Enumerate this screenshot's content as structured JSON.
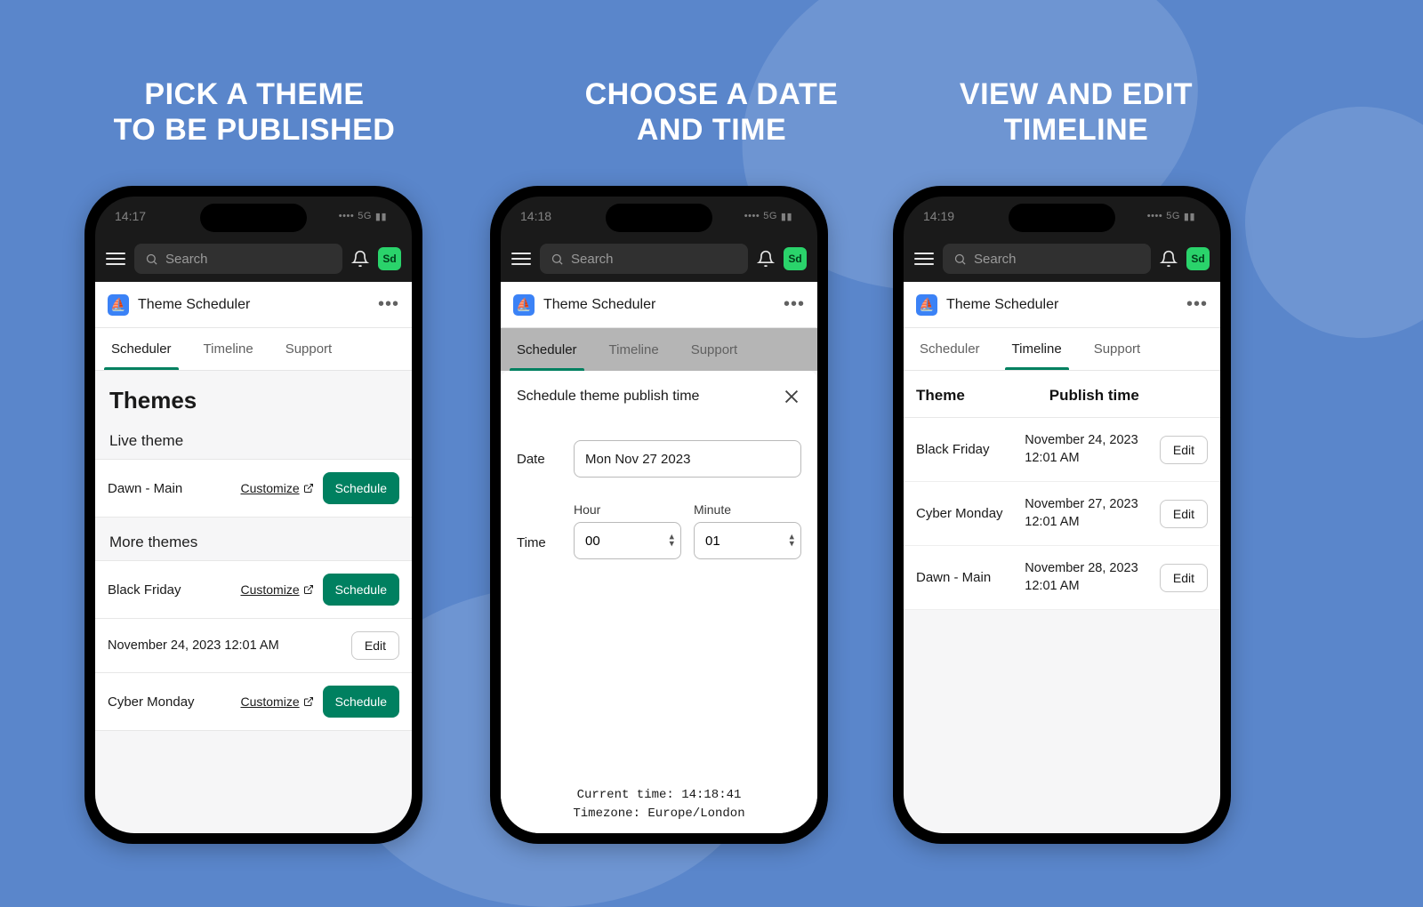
{
  "captions": [
    "PICK A THEME\nTO BE PUBLISHED",
    "CHOOSE A DATE\nAND TIME",
    "VIEW AND EDIT\nTIMELINE"
  ],
  "phones": [
    {
      "clock": "14:17",
      "network": "5G"
    },
    {
      "clock": "14:18",
      "network": "5G"
    },
    {
      "clock": "14:19",
      "network": "5G"
    }
  ],
  "common": {
    "search_placeholder": "Search",
    "user_badge": "Sd",
    "app_title": "Theme Scheduler",
    "tabs": [
      "Scheduler",
      "Timeline",
      "Support"
    ],
    "customize_label": "Customize",
    "schedule_label": "Schedule",
    "edit_label": "Edit"
  },
  "scheduler": {
    "heading": "Themes",
    "live_section": "Live theme",
    "more_section": "More themes",
    "live_theme": "Dawn - Main",
    "more": [
      {
        "name": "Black Friday",
        "scheduled": "November 24, 2023 12:01 AM"
      },
      {
        "name": "Cyber Monday"
      }
    ]
  },
  "modal": {
    "title": "Schedule theme publish time",
    "date_label": "Date",
    "date_value": "Mon Nov 27 2023",
    "time_label": "Time",
    "hour_label": "Hour",
    "minute_label": "Minute",
    "hour_value": "00",
    "minute_value": "01",
    "current_time_line": "Current time: 14:18:41",
    "timezone_line": "Timezone: Europe/London"
  },
  "timeline": {
    "col_theme": "Theme",
    "col_publish": "Publish time",
    "rows": [
      {
        "theme": "Black Friday",
        "publish": "November 24, 2023 12:01 AM"
      },
      {
        "theme": "Cyber Monday",
        "publish": "November 27, 2023 12:01 AM"
      },
      {
        "theme": "Dawn - Main",
        "publish": "November 28, 2023 12:01 AM"
      }
    ]
  }
}
